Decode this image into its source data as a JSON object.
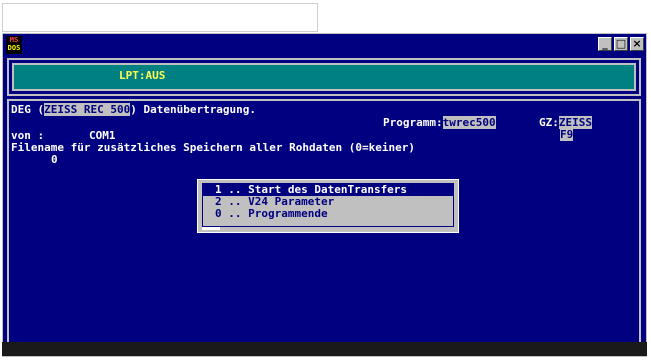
{
  "window": {
    "icon_text_top": "MS",
    "icon_text_bottom": "DOS",
    "controls": [
      "_",
      "□",
      "×"
    ]
  },
  "status": {
    "label": "LPT:AUS"
  },
  "header": {
    "line1_prefix": "DEG (",
    "device": "ZEISS REC 500",
    "line1_suffix": ") Datenübertragung.",
    "programm_label": "Programm:",
    "programm_value": "twrec500",
    "gz_label": "GZ:",
    "gz_value": "ZEISS",
    "gz_sub": "F9",
    "von_label": "von :",
    "von_value": "COM1",
    "filename_prompt": "Filename für zusätzliches Speichern aller Rohdaten (0=keiner)",
    "filename_value": "0"
  },
  "menu": {
    "items": [
      {
        "label": "1 .. Start des DatenTransfers",
        "selected": true
      },
      {
        "label": "2 .. V24 Parameter",
        "selected": false
      },
      {
        "label": "0 .. Programmende",
        "selected": false
      }
    ]
  },
  "colors": {
    "background": "#000080",
    "status_bar": "#008080",
    "status_text": "#ffff55",
    "menu_bg": "#c0c0c0",
    "menu_text": "#000080"
  }
}
